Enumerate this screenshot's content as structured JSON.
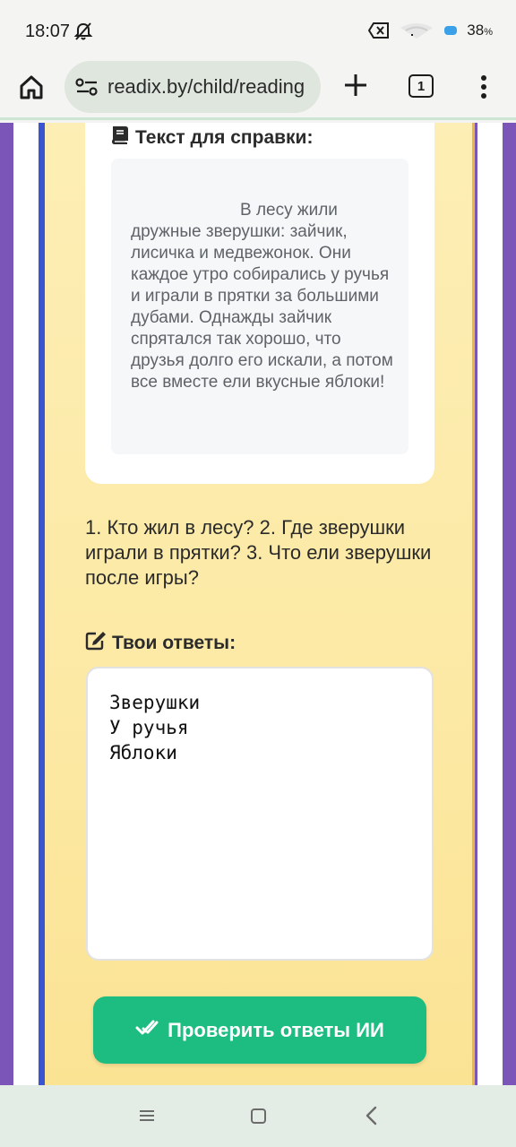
{
  "status_bar": {
    "time": "18:07",
    "battery": "38",
    "battery_unit": "%",
    "icons": [
      "bell-off-icon",
      "sim-off-icon",
      "wifi-icon",
      "battery-icon"
    ]
  },
  "browser": {
    "url": "readix.by/child/reading",
    "tab_count": "1",
    "icons": [
      "home-icon",
      "tune-icon",
      "plus-icon",
      "tabs-icon",
      "more-vert-icon"
    ]
  },
  "reference": {
    "title": "Текст для справки:",
    "icon": "book-icon",
    "text": "В лесу жили дружные зверушки: зайчик, лисичка и медвежонок. Они каждое утро собирались у ручья и играли в прятки за большими дубами. Однажды зайчик спрятался так хорошо, что друзья долго его искали, а потом все вместе ели вкусные яблоки!"
  },
  "questions": "1. Кто жил в лесу? 2. Где зверушки играли в прятки? 3. Что ели зверушки после игры?",
  "answers": {
    "label": "Твои ответы:",
    "icon": "edit-icon",
    "value": "Зверушки\nУ ручья\nЯблоки"
  },
  "check_button": {
    "label": "Проверить ответы ИИ",
    "icon": "check-double-icon",
    "color": "#1dbd82"
  },
  "colors": {
    "page_background": "#7b55b8",
    "card_background": "#fdeeb5",
    "accent_blue": "#3b55d0"
  }
}
